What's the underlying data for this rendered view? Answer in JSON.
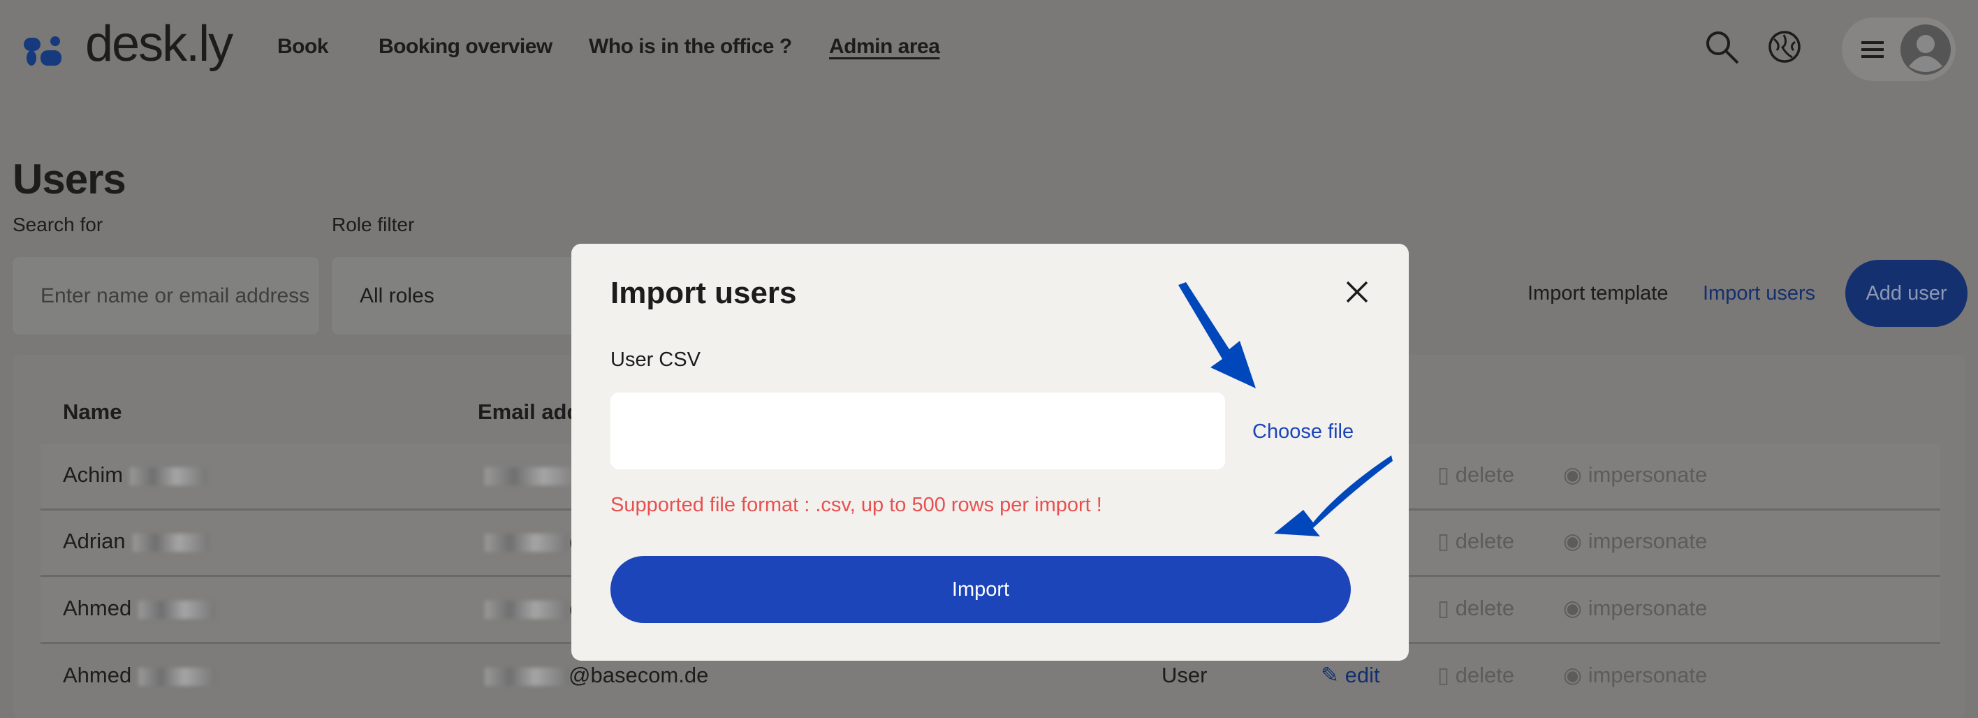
{
  "brand": {
    "name": "desk.ly",
    "color": "#163a7d"
  },
  "nav": {
    "items": [
      "Book",
      "Booking overview",
      "Who is in the office ?",
      "Admin area"
    ],
    "active": "Admin area"
  },
  "header_icons": [
    "search-icon",
    "globe-icon",
    "menu-icon",
    "avatar-icon"
  ],
  "page": {
    "title": "Users",
    "search_label": "Search for",
    "search_placeholder": "Enter name or email address",
    "role_label": "Role filter",
    "role_value": "All roles",
    "import_template": "Import template",
    "import_users": "Import users",
    "add_user": "Add user"
  },
  "table": {
    "headers": [
      "Name",
      "Email address"
    ],
    "rows": [
      {
        "name": "Achim",
        "email": "",
        "role": "",
        "edit": "",
        "delete": "delete",
        "impersonate": "impersonate"
      },
      {
        "name": "Adrian",
        "email": "@",
        "role": "",
        "edit": "",
        "delete": "delete",
        "impersonate": "impersonate"
      },
      {
        "name": "Ahmed",
        "email": "@",
        "role": "",
        "edit": "",
        "delete": "delete",
        "impersonate": "impersonate"
      },
      {
        "name": "Ahmed",
        "email": "@basecom.de",
        "role": "User",
        "edit": "edit",
        "delete": "delete",
        "impersonate": "impersonate"
      }
    ]
  },
  "modal": {
    "title": "Import users",
    "field_label": "User CSV",
    "choose_file": "Choose file",
    "hint": "Supported file format : .csv, up to 500 rows per import !",
    "submit": "Import"
  },
  "colors": {
    "accent": "#1b45b8",
    "error": "#e85050",
    "annotation_arrow": "#0047bb"
  }
}
